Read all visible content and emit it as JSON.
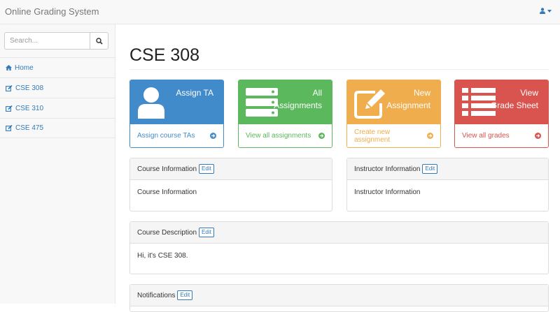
{
  "navbar": {
    "brand": "Online Grading System"
  },
  "sidebar": {
    "search": {
      "placeholder": "Search..."
    },
    "items": [
      {
        "label": "Home",
        "icon": "home-icon"
      },
      {
        "label": "CSE 308",
        "icon": "edit-icon"
      },
      {
        "label": "CSE 310",
        "icon": "edit-icon"
      },
      {
        "label": "CSE 475",
        "icon": "edit-icon"
      }
    ]
  },
  "main": {
    "title": "CSE 308",
    "cards": [
      {
        "title": "Assign TA",
        "link": "Assign course TAs",
        "color": "#428bca",
        "icon": "user-icon"
      },
      {
        "title_lines": [
          "All",
          "Assignments"
        ],
        "link": "View all assignments",
        "color": "#5cb85c",
        "icon": "server-icon"
      },
      {
        "title_lines": [
          "New",
          "Assignment"
        ],
        "link": "Create new assignment",
        "color": "#f0ad4e",
        "icon": "pencil-square-icon"
      },
      {
        "title_lines": [
          "View",
          "Grade Sheet"
        ],
        "link": "View all grades",
        "color": "#d9534f",
        "icon": "list-icon"
      }
    ],
    "panels": {
      "course_info": {
        "heading": "Course Information",
        "edit": "Edit",
        "body": "Course Information"
      },
      "instructor_info": {
        "heading": "Instructor Information",
        "edit": "Edit",
        "body": "Instructor Information"
      },
      "course_description": {
        "heading": "Course Description",
        "edit": "Edit",
        "body": "Hi, it's CSE 308."
      },
      "notifications": {
        "heading": "Notifications",
        "edit": "Edit"
      }
    }
  }
}
